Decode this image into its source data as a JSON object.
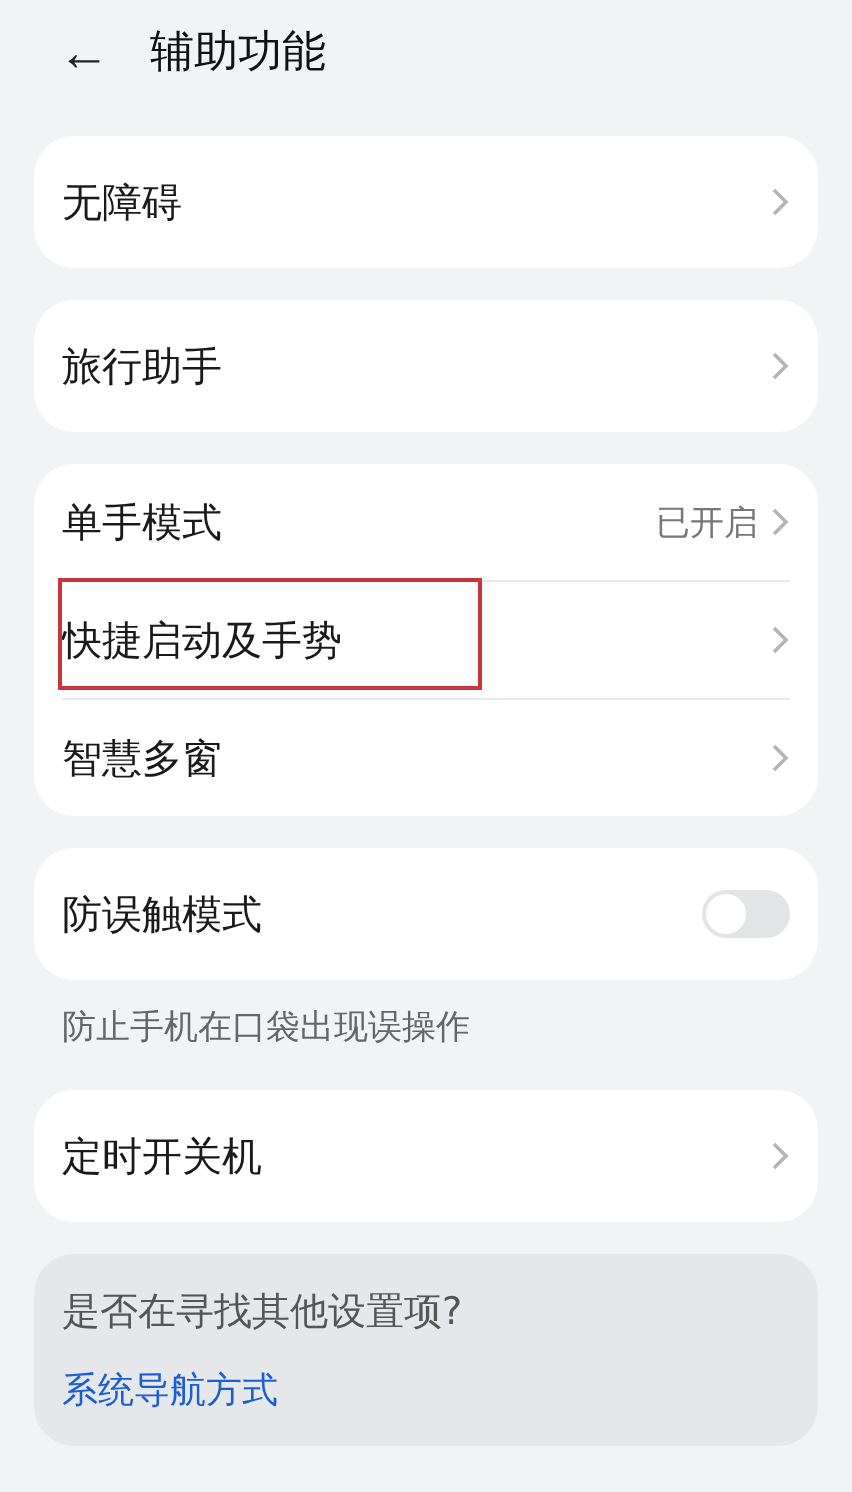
{
  "header": {
    "back": "←",
    "title": "辅助功能"
  },
  "groups": [
    {
      "rows": [
        {
          "kind": "link",
          "label": "无障碍",
          "highlighted": false
        }
      ]
    },
    {
      "rows": [
        {
          "kind": "link",
          "label": "旅行助手",
          "highlighted": false
        }
      ]
    },
    {
      "rows": [
        {
          "kind": "link",
          "label": "单手模式",
          "value": "已开启",
          "highlighted": false
        },
        {
          "kind": "link",
          "label": "快捷启动及手势",
          "highlighted": true
        },
        {
          "kind": "link",
          "label": "智慧多窗",
          "highlighted": false
        }
      ]
    },
    {
      "rows": [
        {
          "kind": "toggle",
          "label": "防误触模式",
          "on": false,
          "highlighted": false
        }
      ],
      "note": "防止手机在口袋出现误操作"
    },
    {
      "rows": [
        {
          "kind": "link",
          "label": "定时开关机",
          "highlighted": false
        }
      ]
    }
  ],
  "suggestion": {
    "question": "是否在寻找其他设置项?",
    "link": "系统导航方式"
  }
}
